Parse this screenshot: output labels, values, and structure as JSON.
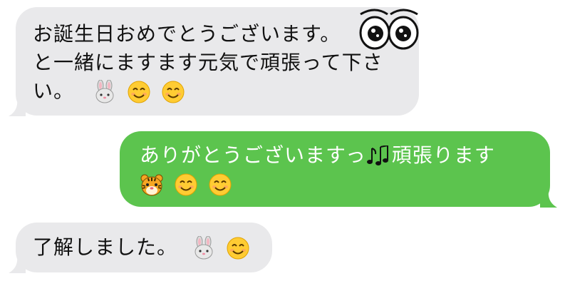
{
  "messages": [
    {
      "direction": "incoming",
      "lines": [
        "お誕生日おめでとうございます。",
        "と一緒にますます元気で頑張って下さ",
        "い。"
      ],
      "emoji": [
        "rabbit-face",
        "smiling-face",
        "smiling-face"
      ]
    },
    {
      "direction": "outgoing",
      "lines": [
        "ありがとうございますっ",
        "頑張ります"
      ],
      "emoji": [
        "tiger-face",
        "smiling-face",
        "smiling-face"
      ],
      "inline_icon": "musical-notes"
    },
    {
      "direction": "incoming",
      "lines": [
        "了解しました。"
      ],
      "emoji": [
        "rabbit-face",
        "smiling-face"
      ]
    }
  ],
  "overlay_icon": "googly-eyes",
  "colors": {
    "incoming_bubble": "#e9e9eb",
    "outgoing_bubble": "#5cc44e",
    "incoming_text": "#111111",
    "outgoing_text": "#ffffff"
  }
}
